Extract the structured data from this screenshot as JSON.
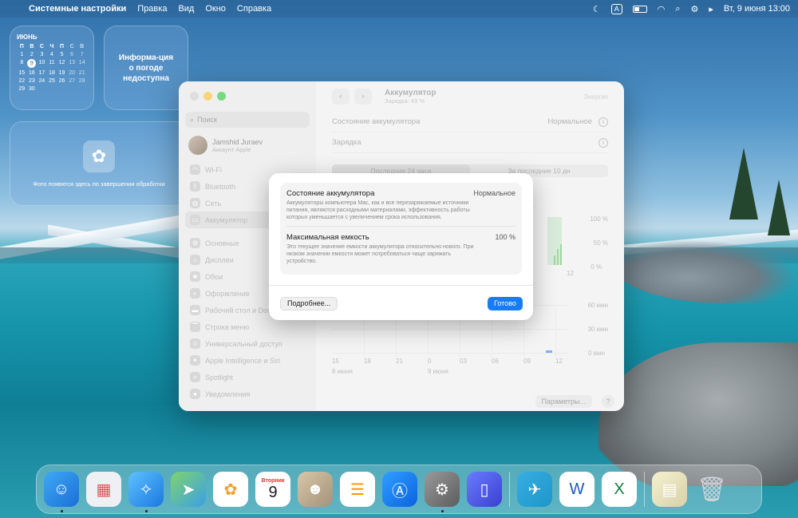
{
  "menubar": {
    "app_name": "Системные настройки",
    "menus": [
      "Правка",
      "Вид",
      "Окно",
      "Справка"
    ],
    "input_source": "A",
    "datetime": "Вт, 9 июня  13:00"
  },
  "widgets": {
    "calendar": {
      "month": "ИЮНЬ",
      "weekdays": [
        "П",
        "В",
        "С",
        "Ч",
        "П",
        "С",
        "В"
      ],
      "weeks": [
        [
          "1",
          "2",
          "3",
          "4",
          "5",
          "6",
          "7"
        ],
        [
          "8",
          "9",
          "10",
          "11",
          "12",
          "13",
          "14"
        ],
        [
          "15",
          "16",
          "17",
          "18",
          "19",
          "20",
          "21"
        ],
        [
          "22",
          "23",
          "24",
          "25",
          "26",
          "27",
          "28"
        ],
        [
          "29",
          "30",
          "",
          "",
          "",
          "",
          ""
        ]
      ],
      "today": "9"
    },
    "weather": {
      "text": "Информа-ция о погоде недоступна"
    },
    "photos": {
      "caption": "Фото появятся здесь по завершении обработки"
    }
  },
  "sidebar": {
    "search_placeholder": "Поиск",
    "account_name": "Jamshid Juraev",
    "account_sub": "Аккаунт Apple",
    "items": [
      {
        "label": "Wi-Fi"
      },
      {
        "label": "Bluetooth"
      },
      {
        "label": "Сеть"
      },
      {
        "label": "Аккумулятор"
      },
      {
        "label": "Основные"
      },
      {
        "label": "Дисплеи"
      },
      {
        "label": "Обои"
      },
      {
        "label": "Оформление"
      },
      {
        "label": "Рабочий стол и Dock"
      },
      {
        "label": "Строка меню"
      },
      {
        "label": "Универсальный доступ"
      },
      {
        "label": "Apple Intelligence и Siri"
      },
      {
        "label": "Spotlight"
      },
      {
        "label": "Уведомления"
      }
    ]
  },
  "content": {
    "title": "Аккумулятор",
    "subtitle": "Зарядка: 43 %",
    "toolbar_right": "Энергия",
    "rows": [
      {
        "label": "Состояние аккумулятора",
        "value": "Нормальное"
      },
      {
        "label": "Зарядка",
        "value": ""
      }
    ],
    "tabs": [
      "Последние 24 часа",
      "За последние 10 дн"
    ],
    "chart_axis": {
      "level_ticks": [
        "100 %",
        "50 %",
        "0 %"
      ],
      "usage_ticks": [
        "60 мин",
        "30 мин",
        "0 мин"
      ],
      "x_ticks": [
        "15",
        "18",
        "21",
        "0",
        "03",
        "06",
        "09",
        "12"
      ],
      "x_small_tick": "12",
      "date_labels": [
        "8 июня",
        "9 июня"
      ]
    },
    "params_button": "Параметры...",
    "help_button": "?"
  },
  "modal": {
    "health": {
      "label": "Состояние аккумулятора",
      "value": "Нормальное",
      "description": "Аккумуляторы компьютера Mac, как и все перезаряжаемые источники питания, являются расходными материалами, эффективность работы которых уменьшается с увеличением срока использования."
    },
    "capacity": {
      "label": "Максимальная емкость",
      "value": "100 %",
      "description": "Это текущее значение емкости аккумулятора относительно нового. При низком значении емкости может потребоваться чаще заряжать устройство."
    },
    "more_button": "Подробнее...",
    "done_button": "Готово"
  },
  "dock": {
    "calendar_day_name": "Вторник",
    "calendar_day_number": "9"
  }
}
